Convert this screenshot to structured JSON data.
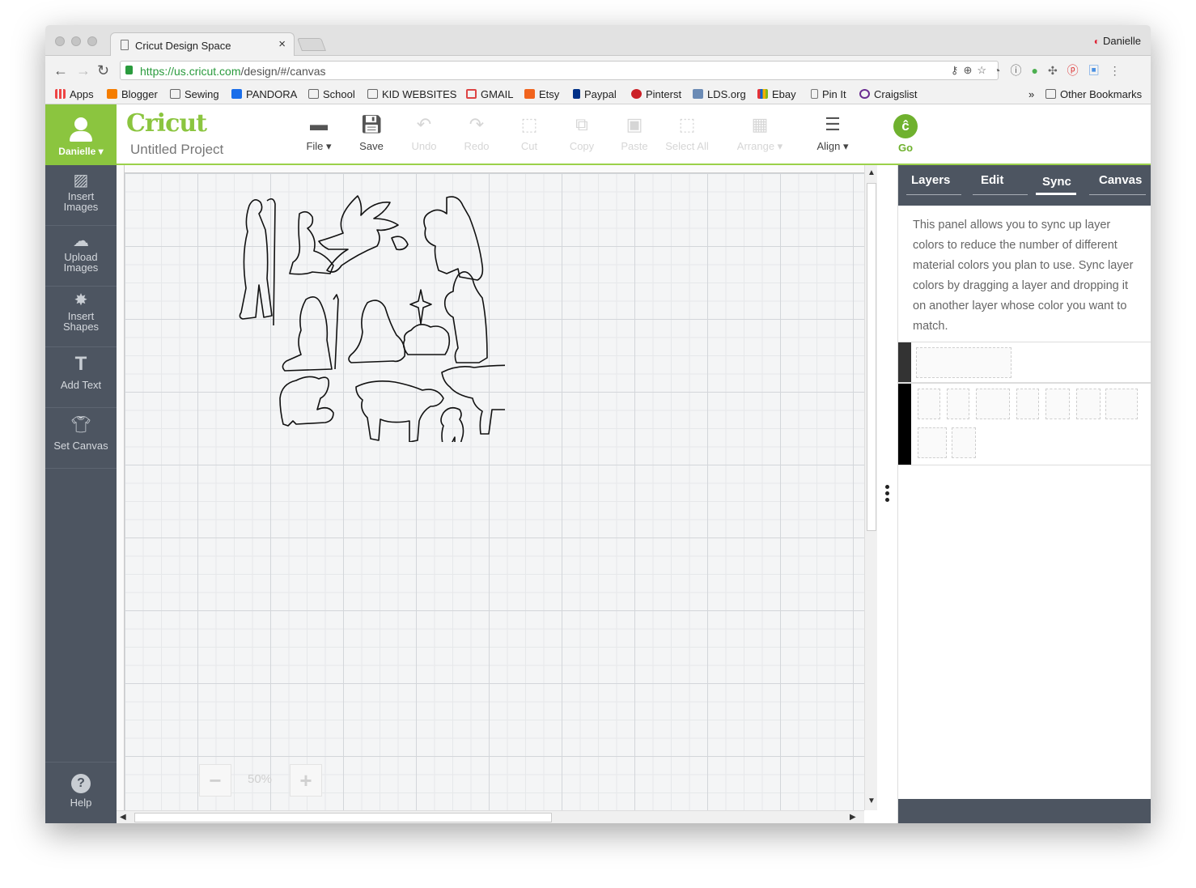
{
  "browser": {
    "tab_title": "Cricut Design Space",
    "tab_close": "×",
    "profile_name": "Danielle",
    "url_host": "https://us.cricut.com",
    "url_path": "/design/#/canvas",
    "bookmarks": [
      "Apps",
      "Blogger",
      "Sewing",
      "PANDORA",
      "School",
      "KID WEBSITES",
      "GMAIL",
      "Etsy",
      "Paypal",
      "Pinterst",
      "LDS.org",
      "Ebay",
      "Pin It",
      "Craigslist"
    ],
    "bookmarks_more": "»",
    "other_bookmarks": "Other Bookmarks"
  },
  "header": {
    "user_name": "Danielle",
    "logo_text": "Cricut",
    "project_title": "Untitled Project",
    "tools": [
      {
        "label": "File",
        "icon": "folder-icon",
        "enabled": true
      },
      {
        "label": "Save",
        "icon": "save-icon",
        "enabled": true
      },
      {
        "label": "Undo",
        "icon": "undo-icon",
        "enabled": false
      },
      {
        "label": "Redo",
        "icon": "redo-icon",
        "enabled": false
      },
      {
        "label": "Cut",
        "icon": "cut-icon",
        "enabled": false
      },
      {
        "label": "Copy",
        "icon": "copy-icon",
        "enabled": false
      },
      {
        "label": "Paste",
        "icon": "paste-icon",
        "enabled": false
      },
      {
        "label": "Select All",
        "icon": "select-all-icon",
        "enabled": false
      },
      {
        "label": "Arrange",
        "icon": "arrange-icon",
        "enabled": false
      },
      {
        "label": "Align",
        "icon": "align-icon",
        "enabled": true
      }
    ],
    "go_label": "Go"
  },
  "sidebar": {
    "items": [
      {
        "label1": "Insert",
        "label2": "Images",
        "icon": "image-icon"
      },
      {
        "label1": "Upload",
        "label2": "Images",
        "icon": "cloud-upload-icon"
      },
      {
        "label1": "Insert",
        "label2": "Shapes",
        "icon": "shapes-icon"
      },
      {
        "label1": "Add Text",
        "label2": "",
        "icon": "text-icon"
      },
      {
        "label1": "Set Canvas",
        "label2": "",
        "icon": "tshirt-icon"
      }
    ],
    "help_label": "Help"
  },
  "canvas": {
    "zoom_level": "50%",
    "zoom_minus": "−",
    "zoom_plus": "+"
  },
  "panel": {
    "tabs": [
      "Layers",
      "Edit",
      "Sync",
      "Canvas"
    ],
    "active_tab": "Sync",
    "description": "This panel allows you to sync up layer colors to reduce the number of different material colors you plan to use. Sync layer colors by dragging a layer and dropping it on another layer whose color you want to match.",
    "layer_colors": [
      "#333333",
      "#000000"
    ]
  },
  "colors": {
    "accent_green": "#8bc53f",
    "sidebar_gray": "#4d5561"
  }
}
